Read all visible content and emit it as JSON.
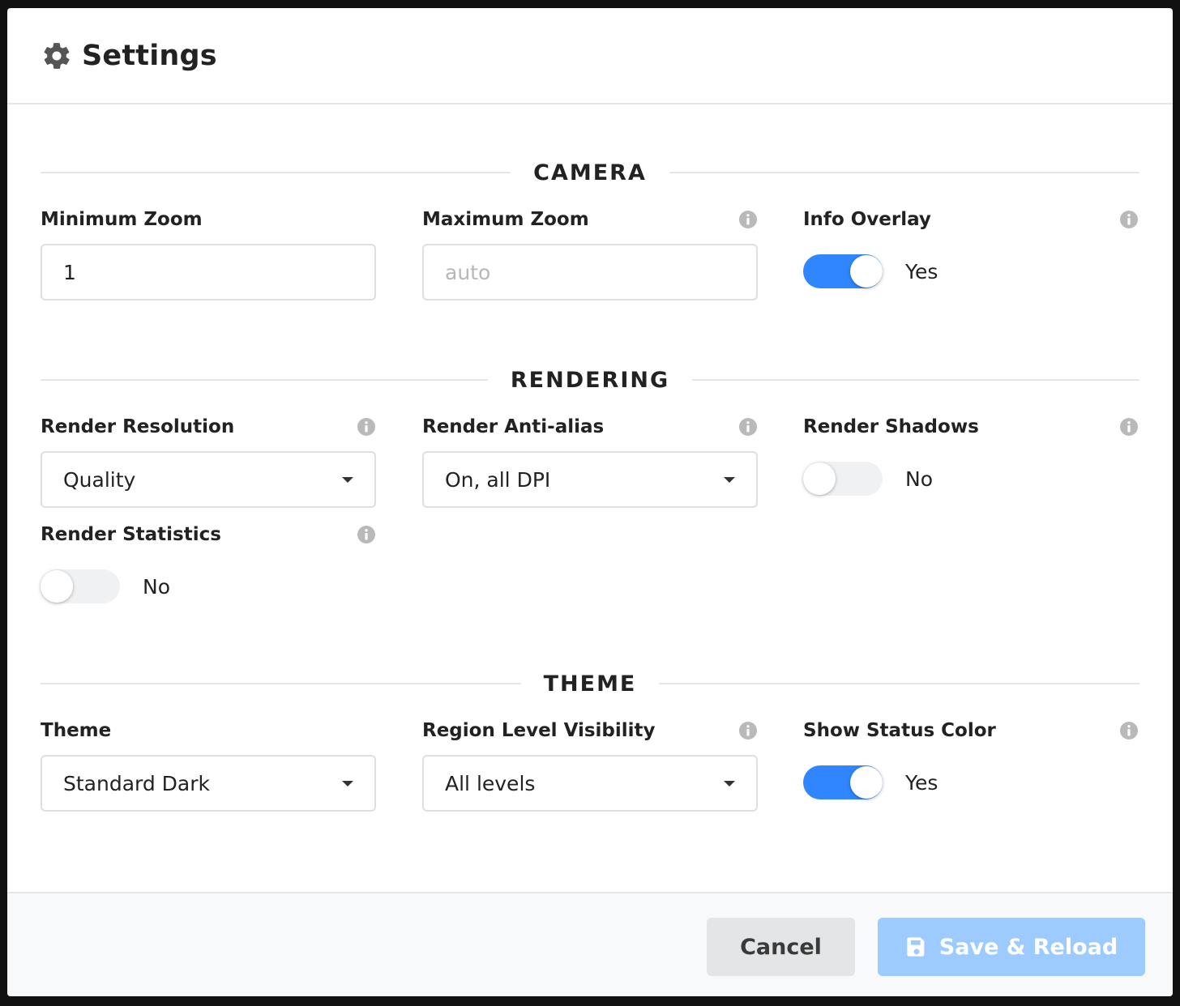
{
  "header": {
    "title": "Settings",
    "icon": "gear-icon"
  },
  "sections": {
    "camera": {
      "title": "CAMERA",
      "min_zoom": {
        "label": "Minimum Zoom",
        "value": "1"
      },
      "max_zoom": {
        "label": "Maximum Zoom",
        "value": "",
        "placeholder": "auto"
      },
      "info_overlay": {
        "label": "Info Overlay",
        "state": "Yes",
        "on": true
      }
    },
    "rendering": {
      "title": "RENDERING",
      "resolution": {
        "label": "Render Resolution",
        "value": "Quality"
      },
      "anti_alias": {
        "label": "Render Anti-alias",
        "value": "On, all DPI"
      },
      "shadows": {
        "label": "Render Shadows",
        "state": "No",
        "on": false
      },
      "statistics": {
        "label": "Render Statistics",
        "state": "No",
        "on": false
      }
    },
    "theme": {
      "title": "THEME",
      "theme": {
        "label": "Theme",
        "value": "Standard Dark"
      },
      "region_level": {
        "label": "Region Level Visibility",
        "value": "All levels"
      },
      "status_color": {
        "label": "Show Status Color",
        "state": "Yes",
        "on": true
      }
    }
  },
  "footer": {
    "cancel_label": "Cancel",
    "save_label": "Save & Reload"
  },
  "colors": {
    "toggle_on": "#2f86ff",
    "save_button": "#9ecbff",
    "cancel_button": "#e4e5e6"
  }
}
